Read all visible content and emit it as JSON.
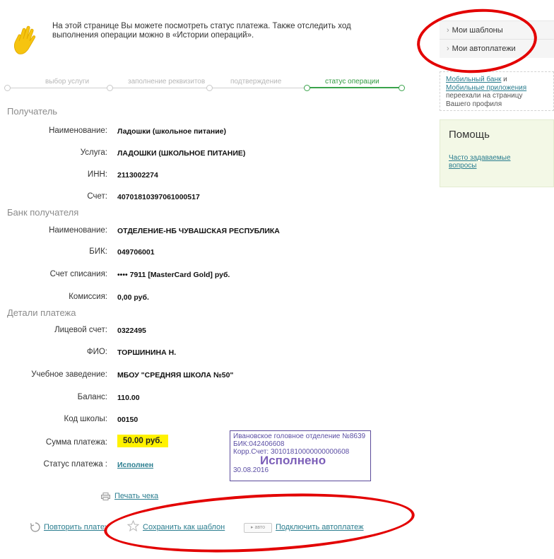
{
  "intro": {
    "text": "На этой странице Вы можете посмотреть статус платежа. Также отследить ход выполнения операции можно в «Истории операций»."
  },
  "steps": [
    {
      "label": "выбор услуги",
      "active": false
    },
    {
      "label": "заполнение реквизитов",
      "active": false
    },
    {
      "label": "подтверждение",
      "active": false
    },
    {
      "label": "статус операции",
      "active": true
    }
  ],
  "recipient": {
    "title": "Получатель",
    "name_label": "Наименование:",
    "name_value": "Ладошки (школьное питание)",
    "service_label": "Услуга:",
    "service_value": "ЛАДОШКИ (ШКОЛЬНОЕ ПИТАНИЕ)",
    "inn_label": "ИНН:",
    "inn_value": "2113002274",
    "account_label": "Счет:",
    "account_value": "40701810397061000517"
  },
  "bank": {
    "title": "Банк получателя",
    "name_label": "Наименование:",
    "name_value": "ОТДЕЛЕНИЕ-НБ ЧУВАШСКАЯ РЕСПУБЛИКА",
    "bik_label": "БИК:",
    "bik_value": "049706001",
    "debit_label": "Счет списания:",
    "debit_value": "•••• 7911  [MasterCard Gold]  руб.",
    "fee_label": "Комиссия:",
    "fee_value": "0,00 руб."
  },
  "details": {
    "title": "Детали платежа",
    "personal_label": "Лицевой счет:",
    "personal_value": "0322495",
    "fio_label": "ФИО:",
    "fio_value": "ТОРШИНИНА Н.",
    "school_label": "Учебное заведение:",
    "school_value": "МБОУ \"СРЕДНЯЯ ШКОЛА №50\"",
    "balance_label": "Баланс:",
    "balance_value": "110.00",
    "code_label": "Код школы:",
    "code_value": "00150",
    "sum_label": "Сумма платежа:",
    "sum_value": "50.00 руб.",
    "status_label": "Статус платежа :",
    "status_value": "Исполнен"
  },
  "stamp": {
    "line1": "Ивановское головное отделение №8639",
    "line2": "БИК:042406608",
    "line3": "Корр.Счет: 30101810000000000608",
    "status": "Исполнено",
    "date": "30.08.2016"
  },
  "actions": {
    "print": "Печать чека",
    "repeat": "Повторить платеж",
    "save_template": "Сохранить как шаблон",
    "auto_badge": "авто",
    "autopay": "Подключить автоплатеж"
  },
  "sidebar": {
    "templates": "Мои шаблоны",
    "autopayments": "Мои автоплатежи",
    "mobile_link1": "Мобильный банк",
    "mobile_and": " и ",
    "mobile_link2": "Мобильные приложения",
    "mobile_text": " переехали на страницу Вашего профиля",
    "help_title": "Помощь",
    "faq": "Часто задаваемые вопросы"
  },
  "colors": {
    "accent_green": "#3aa34b",
    "link": "#2a7d8f",
    "highlight": "#fff200",
    "annotation_red": "#e30000",
    "stamp_purple": "#5b4ea4"
  }
}
